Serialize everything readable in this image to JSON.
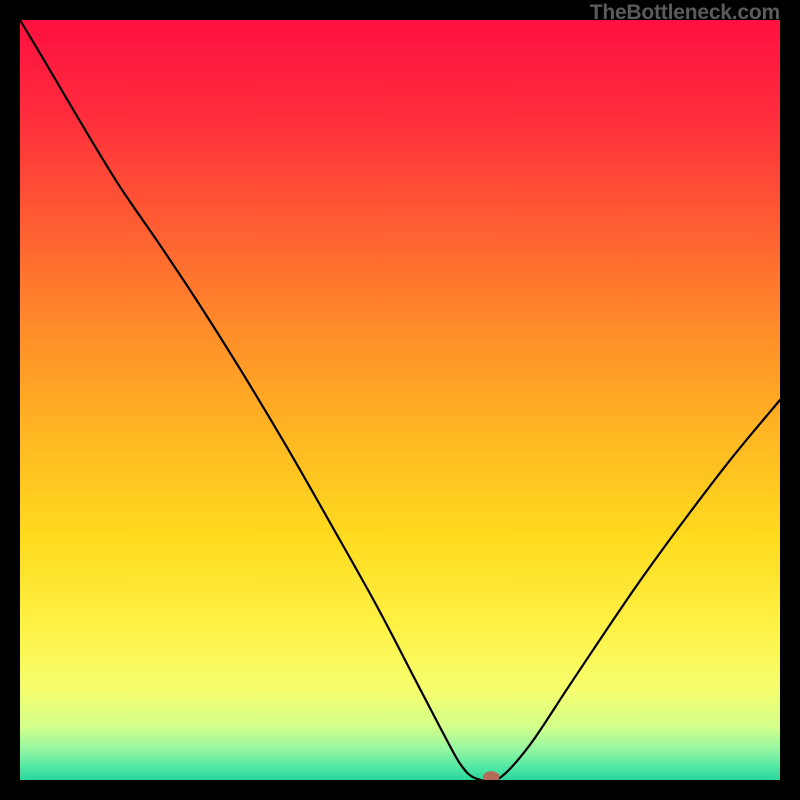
{
  "watermark": "TheBottleneck.com",
  "chart_data": {
    "type": "line",
    "title": "",
    "xlabel": "",
    "ylabel": "",
    "xlim": [
      0,
      100
    ],
    "ylim": [
      0,
      100
    ],
    "grid": false,
    "legend": false,
    "background_gradient": {
      "stops": [
        {
          "offset": 0.0,
          "color": "#ff1040"
        },
        {
          "offset": 0.12,
          "color": "#ff2b3d"
        },
        {
          "offset": 0.26,
          "color": "#ff5a33"
        },
        {
          "offset": 0.4,
          "color": "#ff8a2a"
        },
        {
          "offset": 0.54,
          "color": "#ffb522"
        },
        {
          "offset": 0.68,
          "color": "#ffdb1e"
        },
        {
          "offset": 0.8,
          "color": "#fff246"
        },
        {
          "offset": 0.88,
          "color": "#f6ff6e"
        },
        {
          "offset": 0.93,
          "color": "#d3ff8a"
        },
        {
          "offset": 0.96,
          "color": "#93f7a1"
        },
        {
          "offset": 0.985,
          "color": "#4de6a4"
        },
        {
          "offset": 1.0,
          "color": "#29d59a"
        }
      ]
    },
    "series": [
      {
        "name": "bottleneck-curve",
        "color": "#000000",
        "x": [
          0.0,
          3.0,
          8.0,
          13.0,
          18.0,
          23.0,
          29.0,
          35.0,
          41.0,
          47.0,
          52.0,
          55.5,
          58.0,
          60.0,
          63.0,
          67.0,
          72.0,
          77.0,
          82.0,
          88.0,
          94.0,
          100.0
        ],
        "y": [
          100.0,
          95.0,
          86.5,
          78.3,
          71.0,
          63.5,
          54.0,
          44.0,
          33.5,
          22.8,
          13.2,
          6.5,
          2.0,
          0.2,
          0.2,
          4.5,
          12.0,
          19.5,
          26.8,
          35.0,
          42.8,
          50.0
        ]
      }
    ],
    "annotations": {
      "optimal_marker": {
        "x": 62.0,
        "y": 0.4,
        "rx": 1.1,
        "ry": 0.75,
        "color": "#b46a56"
      }
    }
  }
}
